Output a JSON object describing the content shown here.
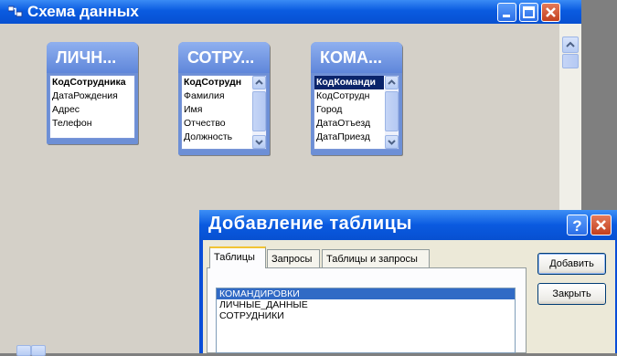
{
  "window": {
    "title": "Схема данных",
    "icon": "relationships-icon",
    "controls": [
      "minimize-icon",
      "maximize-icon",
      "close-icon"
    ]
  },
  "tables": [
    {
      "title": "ЛИЧН...",
      "fields": [
        "КодСотрудника",
        "ДатаРождения",
        "Адрес",
        "Телефон"
      ],
      "key_field": "КодСотрудника",
      "scrollbar": false
    },
    {
      "title": "СОТРУ...",
      "fields": [
        "КодСотрудн",
        "Фамилия",
        "Имя",
        "Отчество",
        "Должность"
      ],
      "key_field": "КодСотрудн",
      "scrollbar": true
    },
    {
      "title": "КОМА...",
      "fields": [
        "КодКоманди",
        "КодСотрудн",
        "Город",
        "ДатаОтъезд",
        "ДатаПриезд"
      ],
      "key_field": "КодКоманди",
      "selected_field": "КодКоманди",
      "scrollbar": true
    }
  ],
  "dialog": {
    "title": "Добавление таблицы",
    "controls": [
      "help-icon",
      "close-icon"
    ],
    "tabs": [
      "Таблицы",
      "Запросы",
      "Таблицы и запросы"
    ],
    "active_tab": "Таблицы",
    "items": [
      "КОМАНДИРОВКИ",
      "ЛИЧНЫЕ_ДАННЫЕ",
      "СОТРУДНИКИ"
    ],
    "selected_item": "КОМАНДИРОВКИ",
    "buttons": {
      "add": "Добавить",
      "close": "Закрыть"
    }
  },
  "colors": {
    "titlebar": "#0a5be0",
    "table_header": "#6d8fd6",
    "selection": "#316ac5",
    "workspace": "#d4d0c8"
  }
}
